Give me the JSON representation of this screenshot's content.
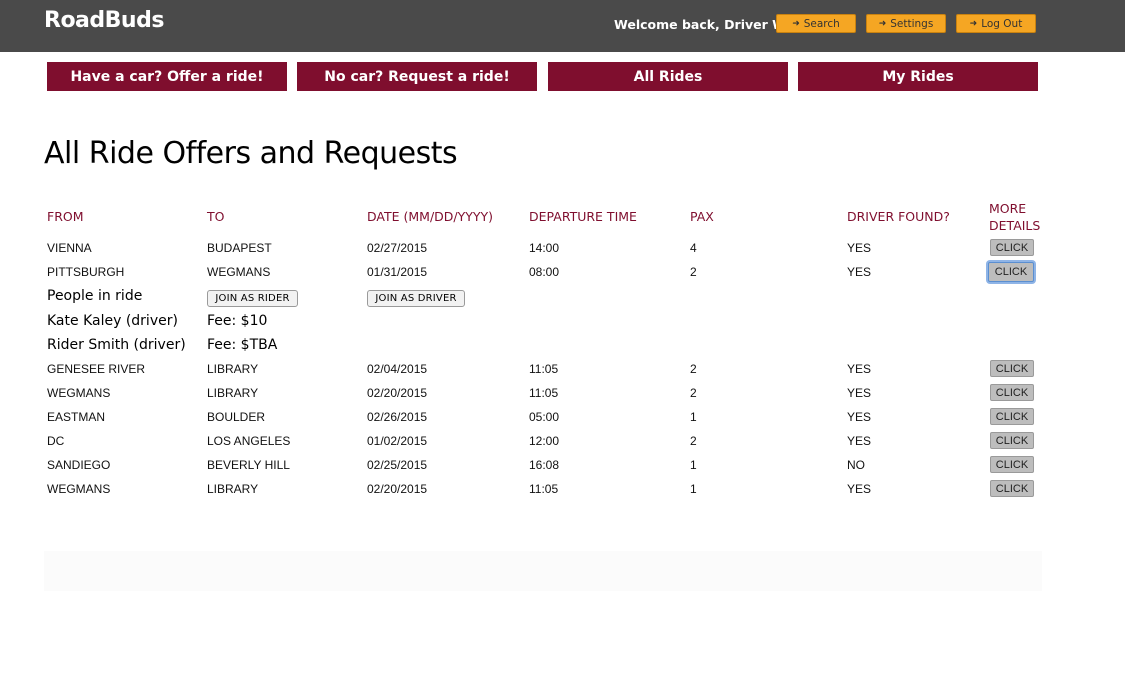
{
  "header": {
    "brand": "RoadBuds",
    "welcome": "Welcome back, Driver Woo!",
    "search_label": "Search",
    "settings_label": "Settings",
    "logout_label": "Log Out"
  },
  "nav": {
    "offer": "Have a car? Offer a ride!",
    "request": "No car? Request a ride!",
    "all": "All Rides",
    "my": "My Rides"
  },
  "page_title": "All Ride Offers and Requests",
  "table": {
    "columns": {
      "from": "FROM",
      "to": "TO",
      "date": "DATE (MM/DD/YYYY)",
      "time": "DEPARTURE TIME",
      "pax": "PAX",
      "driver_found": "DRIVER FOUND?",
      "more_line1": "MORE",
      "more_line2": "DETAILS"
    },
    "click_label": "CLICK",
    "rows": [
      {
        "from": "VIENNA",
        "to": "BUDAPEST",
        "date": "02/27/2015",
        "time": "14:00",
        "pax": "4",
        "driver": "YES"
      },
      {
        "from": "PITTSBURGH",
        "to": "WEGMANS",
        "date": "01/31/2015",
        "time": "08:00",
        "pax": "2",
        "driver": "YES"
      },
      {
        "from": "GENESEE RIVER",
        "to": "LIBRARY",
        "date": "02/04/2015",
        "time": "11:05",
        "pax": "2",
        "driver": "YES"
      },
      {
        "from": "WEGMANS",
        "to": "LIBRARY",
        "date": "02/20/2015",
        "time": "11:05",
        "pax": "2",
        "driver": "YES"
      },
      {
        "from": "EASTMAN",
        "to": "BOULDER",
        "date": "02/26/2015",
        "time": "05:00",
        "pax": "1",
        "driver": "YES"
      },
      {
        "from": "DC",
        "to": "LOS ANGELES",
        "date": "01/02/2015",
        "time": "12:00",
        "pax": "2",
        "driver": "YES"
      },
      {
        "from": "SANDIEGO",
        "to": "BEVERLY HILL",
        "date": "02/25/2015",
        "time": "16:08",
        "pax": "1",
        "driver": "NO"
      },
      {
        "from": "WEGMANS",
        "to": "LIBRARY",
        "date": "02/20/2015",
        "time": "11:05",
        "pax": "1",
        "driver": "YES"
      }
    ]
  },
  "details": {
    "people_label": "People in ride",
    "join_rider": "JOIN AS RIDER",
    "join_driver": "JOIN AS DRIVER",
    "people": [
      {
        "name": "Kate Kaley (driver)",
        "fee": "Fee: $10"
      },
      {
        "name": "Rider Smith (driver)",
        "fee": "Fee: $TBA"
      }
    ]
  },
  "icons": {
    "search": "sign-in-icon",
    "settings": "sign-in-icon",
    "logout": "sign-in-icon"
  },
  "colors": {
    "accent": "#7f0e2e",
    "topbar": "#4a4a4a",
    "orange": "#f5a623"
  }
}
